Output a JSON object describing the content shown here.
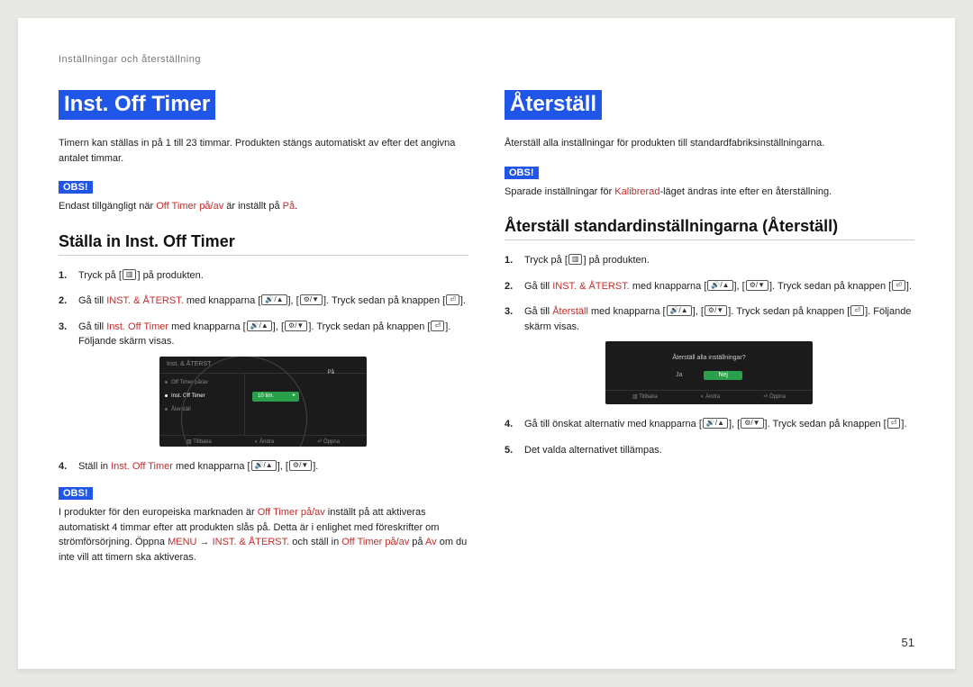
{
  "header": "Inställningar och återställning",
  "page_number": "51",
  "common": {
    "obs_label": "OBS!",
    "icons": {
      "menu": "▥",
      "vol_up": "🔊/▲",
      "ch_down": "⚙/▼",
      "enter": "⏎"
    }
  },
  "left": {
    "title": "Inst. Off Timer",
    "intro": "Timern kan ställas in på 1 till 23 timmar. Produkten stängs automatiskt av efter det angivna antalet timmar.",
    "note_before": "Endast tillgängligt när ",
    "note_accent1": "Off Timer på/av",
    "note_mid": " är inställt på ",
    "note_accent2": "På",
    "note_after": ".",
    "subheading": "Ställa in Inst. Off Timer",
    "steps": {
      "s1": "Tryck på [",
      "s1b": "] på produkten.",
      "s2a": "Gå till ",
      "s2_acc": "INST. & ÅTERST.",
      "s2b": " med knapparna [",
      "s2c": "], [",
      "s2d": "]. Tryck sedan på knappen [",
      "s2e": "].",
      "s3a": "Gå till ",
      "s3_acc": "Inst. Off Timer",
      "s3b": " med knapparna [",
      "s3c": "], [",
      "s3d": "]. Tryck sedan på knappen [",
      "s3e": "]. Följande skärm visas.",
      "s4a": "Ställ in ",
      "s4_acc": "Inst. Off Timer",
      "s4b": " med knapparna [",
      "s4c": "], [",
      "s4d": "]."
    },
    "osd": {
      "title": "Inst. & ÅTERST.",
      "row1": "Off Timer på/av",
      "row2": "Inst. Off Timer",
      "row3": "Återställ",
      "val_pa": "På",
      "val_green": "10 tim.",
      "f1": "Tillbaka",
      "f2": "Ändra",
      "f3": "Öppna"
    },
    "note2": {
      "t1": "I produkter för den europeiska marknaden är ",
      "a1": "Off Timer på/av",
      "t2": " inställt på att aktiveras automatiskt 4 timmar efter att produkten slås på. Detta är i enlighet med föreskrifter om strömförsörjning. Öppna ",
      "a2": "MENU",
      "arrow": " → ",
      "a3": "INST. & ÅTERST.",
      "t3": " och ställ in ",
      "a4": "Off Timer på/av",
      "t4": " på ",
      "a5": "Av",
      "t5": " om du inte vill att timern ska aktiveras."
    }
  },
  "right": {
    "title": "Återställ",
    "intro": "Återställ alla inställningar för produkten till standardfabriksinställningarna.",
    "note_before": "Sparade inställningar för ",
    "note_accent": "Kalibrerad",
    "note_after": "-läget ändras inte efter en återställning.",
    "subheading": "Återställ standardinställningarna (Återställ)",
    "steps": {
      "s1": "Tryck på [",
      "s1b": "] på produkten.",
      "s2a": "Gå till ",
      "s2_acc": "INST. & ÅTERST.",
      "s2b": " med knapparna [",
      "s2c": "], [",
      "s2d": "]. Tryck sedan på knappen [",
      "s2e": "].",
      "s3a": "Gå till ",
      "s3_acc": "Återställ",
      "s3b": " med knapparna [",
      "s3c": "], [",
      "s3d": "]. Tryck sedan på knappen [",
      "s3e": "]. Följande skärm visas.",
      "s4a": "Gå till önskat alternativ med knapparna [",
      "s4b": "], [",
      "s4c": "]. Tryck sedan på knappen [",
      "s4d": "].",
      "s5": "Det valda alternativet tillämpas."
    },
    "osd": {
      "q": "Återställ alla inställningar?",
      "opt1": "Ja",
      "opt2": "Nej",
      "f1": "Tillbaka",
      "f2": "Ändra",
      "f3": "Öppna"
    }
  }
}
